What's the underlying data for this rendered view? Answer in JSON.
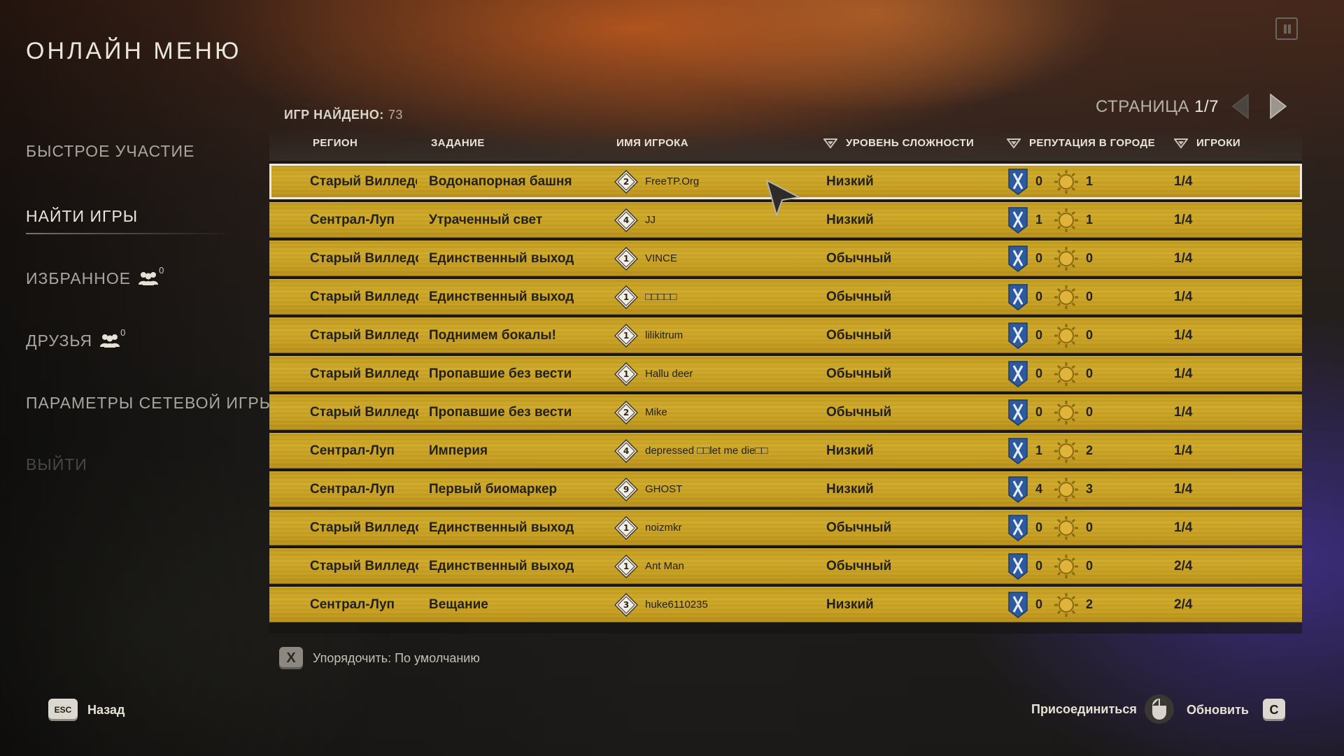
{
  "title": "ОНЛАЙН МЕНЮ",
  "sidebar": {
    "items": [
      {
        "label": "БЫСТРОЕ УЧАСТИЕ"
      },
      {
        "label": "НАЙТИ ИГРЫ"
      },
      {
        "label": "ИЗБРАННОЕ",
        "count": "0"
      },
      {
        "label": "ДРУЗЬЯ",
        "count": "0"
      },
      {
        "label": "ПАРАМЕТРЫ СЕТЕВОЙ ИГРЫ"
      },
      {
        "label": "ВЫЙТИ"
      }
    ],
    "active": "НАЙТИ ИГРЫ"
  },
  "found": {
    "label": "ИГР НАЙДЕНО:",
    "count": "73"
  },
  "pager": {
    "label": "СТРАНИЦА",
    "page": "1/7"
  },
  "table": {
    "headers": {
      "region": "РЕГИОН",
      "mission": "ЗАДАНИЕ",
      "player": "ИМЯ ИГРОКА",
      "difficulty": "УРОВЕНЬ СЛОЖНОСТИ",
      "reputation": "РЕПУТАЦИЯ В ГОРОДЕ",
      "players": "ИГРОКИ"
    },
    "rows": [
      {
        "region": "Старый Вилледор",
        "mission": "Водонапорная башня",
        "level": "2",
        "player": "FreeTP.Org",
        "difficulty": "Низкий",
        "rep_a": "0",
        "rep_b": "1",
        "players": "1/4"
      },
      {
        "region": "Сентрал-Луп",
        "mission": "Утраченный свет",
        "level": "4",
        "player": "JJ",
        "difficulty": "Низкий",
        "rep_a": "1",
        "rep_b": "1",
        "players": "1/4"
      },
      {
        "region": "Старый Вилледо",
        "mission": "Единственный выход",
        "level": "1",
        "player": "VINCE",
        "difficulty": "Обычный",
        "rep_a": "0",
        "rep_b": "0",
        "players": "1/4"
      },
      {
        "region": "Старый Вилледо",
        "mission": "Единственный выход",
        "level": "1",
        "player": "□□□□□",
        "difficulty": "Обычный",
        "rep_a": "0",
        "rep_b": "0",
        "players": "1/4"
      },
      {
        "region": "Старый Вилледо",
        "mission": "Поднимем бокалы!",
        "level": "1",
        "player": "lilikitrum",
        "difficulty": "Обычный",
        "rep_a": "0",
        "rep_b": "0",
        "players": "1/4"
      },
      {
        "region": "Старый Вилледо",
        "mission": "Пропавшие без вести",
        "level": "1",
        "player": "Hallu deer",
        "difficulty": "Обычный",
        "rep_a": "0",
        "rep_b": "0",
        "players": "1/4"
      },
      {
        "region": "Старый Вилледо",
        "mission": "Пропавшие без вести",
        "level": "2",
        "player": "Mike",
        "difficulty": "Обычный",
        "rep_a": "0",
        "rep_b": "0",
        "players": "1/4"
      },
      {
        "region": "Сентрал-Луп",
        "mission": "Империя",
        "level": "4",
        "player": "depressed □□let me die□□",
        "difficulty": "Низкий",
        "rep_a": "1",
        "rep_b": "2",
        "players": "1/4"
      },
      {
        "region": "Сентрал-Луп",
        "mission": "Первый биомаркер",
        "level": "9",
        "player": "GHOST",
        "difficulty": "Низкий",
        "rep_a": "4",
        "rep_b": "3",
        "players": "1/4"
      },
      {
        "region": "Старый Вилледо",
        "mission": "Единственный выход",
        "level": "1",
        "player": "noizmkr",
        "difficulty": "Обычный",
        "rep_a": "0",
        "rep_b": "0",
        "players": "1/4"
      },
      {
        "region": "Старый Вилледо",
        "mission": "Единственный выход",
        "level": "1",
        "player": "Ant Man",
        "difficulty": "Обычный",
        "rep_a": "0",
        "rep_b": "0",
        "players": "2/4"
      },
      {
        "region": "Сентрал-Луп",
        "mission": "Вещание",
        "level": "3",
        "player": "huke6110235",
        "difficulty": "Низкий",
        "rep_a": "0",
        "rep_b": "2",
        "players": "2/4"
      }
    ]
  },
  "sort_hint": {
    "key": "X",
    "label": "Упорядочить: По умолчанию"
  },
  "bottom": {
    "back_key": "ESC",
    "back_label": "Назад",
    "join_label": "Присоединиться",
    "refresh_label": "Обновить",
    "refresh_key": "C"
  },
  "colors": {
    "row": "#c9a022",
    "text_dark": "#24211d",
    "shield": "#2d5a9e",
    "accent_light": "#e9e5da"
  },
  "icons": [
    "pause-icon",
    "friends-icon",
    "arrow-left-icon",
    "arrow-right-icon",
    "sort-icon",
    "level-diamond-icon",
    "shield-icon",
    "sun-icon",
    "mouse-icon",
    "cursor-icon"
  ]
}
